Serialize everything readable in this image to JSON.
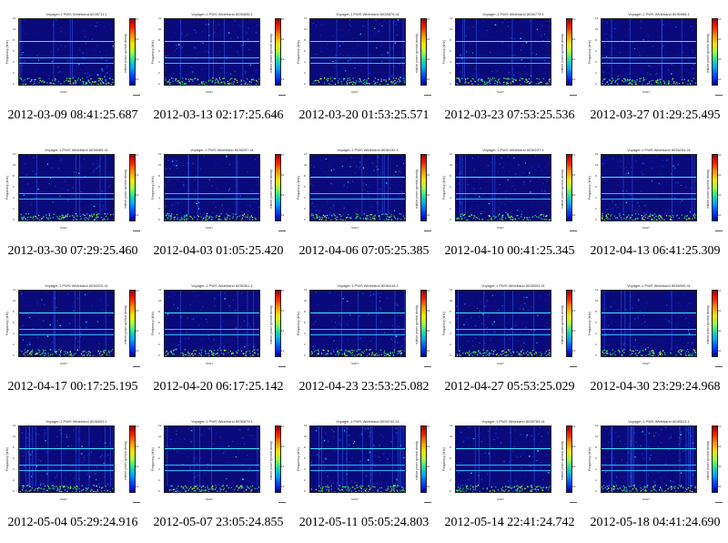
{
  "colors": {
    "background": "#ffffff",
    "caption": "#000000"
  },
  "panels": [
    {
      "caption": "2012-03-09 08:41:25.687",
      "title": "Voyager-1 PWS Wideband 8035711.1"
    },
    {
      "caption": "2012-03-13 02:17:25.646",
      "title": "Voyager-1 PWS Wideband 8035836.1"
    },
    {
      "caption": "2012-03-20 01:53:25.571",
      "title": "Voyager-1 PWS Wideband 8035879.41"
    },
    {
      "caption": "2012-03-23 07:53:25.536",
      "title": "Voyager-1 PWS Wideband 8035779.1"
    },
    {
      "caption": "2012-03-27 01:29:25.495",
      "title": "Voyager-1 PWS Wideband 8035988.1"
    },
    {
      "caption": "2012-03-30 07:29:25.460",
      "title": "Voyager-1 PWS Wideband 8036085.41"
    },
    {
      "caption": "2012-04-03 01:05:25.420",
      "title": "Voyager-1 PWS Wideband 8036097.41"
    },
    {
      "caption": "2012-04-06 07:05:25.385",
      "title": "Voyager-1 PWS Wideband 8036155.1"
    },
    {
      "caption": "2012-04-10 00:41:25.345",
      "title": "Voyager-1 PWS Wideband 8036197.1"
    },
    {
      "caption": "2012-04-13 06:41:25.309",
      "title": "Voyager-1 PWS Wideband 8036254.41"
    },
    {
      "caption": "2012-04-17 00:17:25.195",
      "title": "Voyager-1 PWS Wideband 8036319.41"
    },
    {
      "caption": "2012-04-20 06:17:25.142",
      "title": "Voyager-1 PWS Wideband 8036361.1"
    },
    {
      "caption": "2012-04-23 23:53:25.082",
      "title": "Voyager-1 PWS Wideband 8036418.1"
    },
    {
      "caption": "2012-04-27 05:53:25.029",
      "title": "Voyager-1 PWS Wideband 8036503.41"
    },
    {
      "caption": "2012-04-30 23:29:24.968",
      "title": "Voyager-1 PWS Wideband 8036559.41"
    },
    {
      "caption": "2012-05-04 05:29:24.916",
      "title": "Voyager-1 PWS Wideband 8036593.1"
    },
    {
      "caption": "2012-05-07 23:05:24.855",
      "title": "Voyager-1 PWS Wideband 8036679.1"
    },
    {
      "caption": "2012-05-11 05:05:24.803",
      "title": "Voyager-1 PWS Wideband 8036742.41"
    },
    {
      "caption": "2012-05-14 22:41:24.742",
      "title": "Voyager-1 PWS Wideband 8036763.41"
    },
    {
      "caption": "2012-05-18 04:41:24.690",
      "title": "Voyager-1 PWS Wideband 8036813.1"
    }
  ],
  "axis": {
    "ylabel": "Frequency (kHz)",
    "yticks": [
      "12",
      "10",
      "8",
      "6",
      "4",
      "2",
      "0"
    ],
    "cbar_label": "relative power spectral density",
    "cbar_ticks": [
      "10",
      "10",
      "10",
      "10"
    ],
    "xunit": "SCET"
  }
}
